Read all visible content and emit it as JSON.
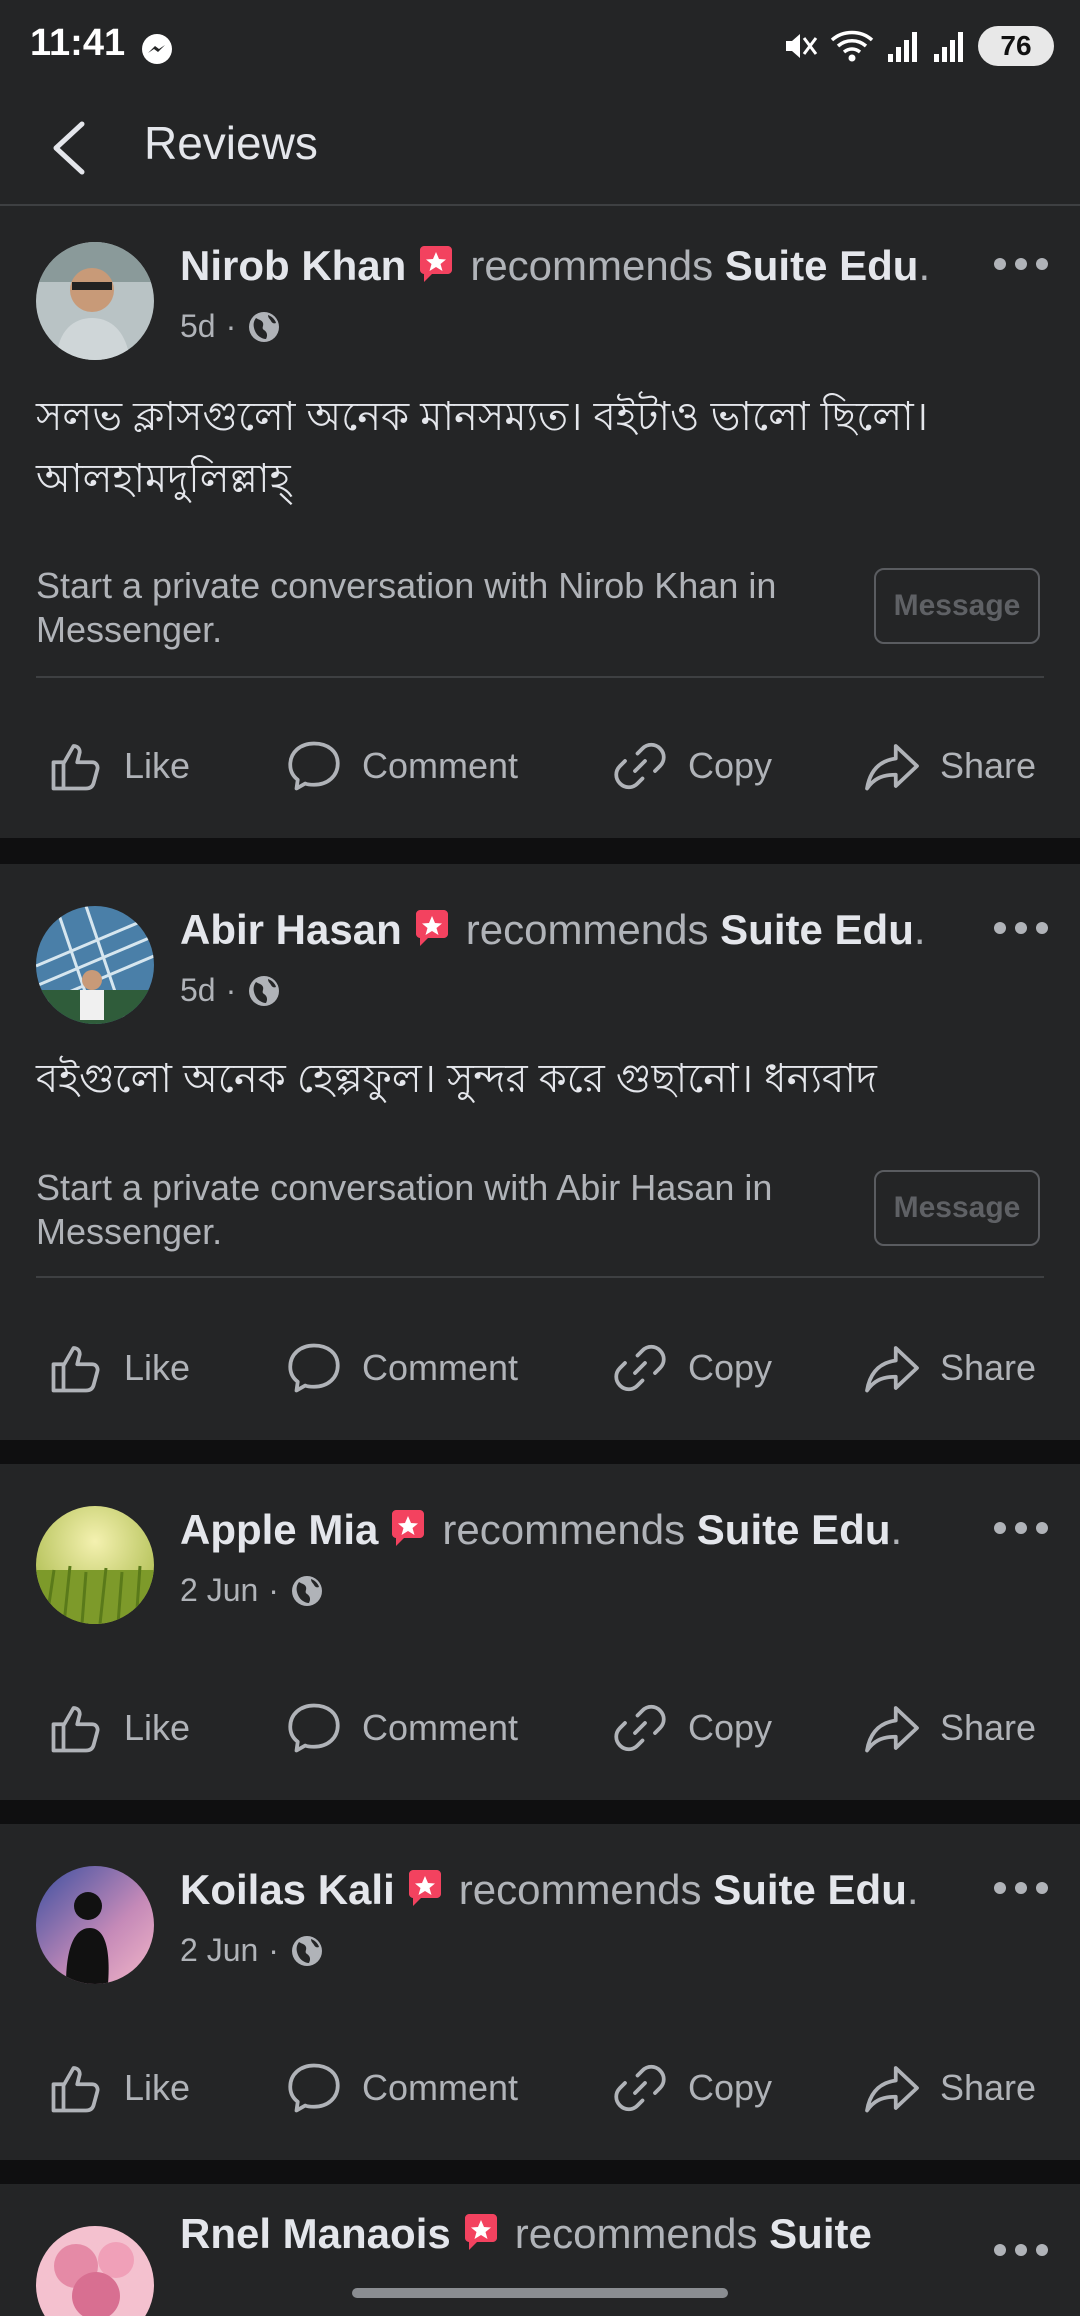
{
  "status_bar": {
    "time": "11:41",
    "battery": "76"
  },
  "header": {
    "title": "Reviews"
  },
  "reviews": [
    {
      "name": "Nirob Khan",
      "action": "recommends",
      "page": "Suite Edu",
      "time": "5d",
      "text": "সলভ ক্লাসগুলো অনেক মানসম্যত। বইটাও ভালো ছিলো। আলহামদুলিল্লাহ্",
      "private_note": "Start a private conversation with Nirob Khan in Messenger.",
      "message_label": "Message"
    },
    {
      "name": "Abir Hasan",
      "action": "recommends",
      "page": "Suite Edu",
      "time": "5d",
      "text": "বইগুলো অনেক হেল্পফুল। সুন্দর করে গুছানো। ধন্যবাদ",
      "private_note": "Start a private conversation with Abir Hasan in Messenger.",
      "message_label": "Message"
    },
    {
      "name": "Apple Mia",
      "action": "recommends",
      "page": "Suite Edu",
      "time": "2 Jun"
    },
    {
      "name": "Koilas Kali",
      "action": "recommends",
      "page": "Suite Edu",
      "time": "2 Jun"
    },
    {
      "name": "Rnel Manaois",
      "action": "recommends",
      "page": "Suite"
    }
  ],
  "actions": {
    "like": "Like",
    "comment": "Comment",
    "copy": "Copy",
    "share": "Share"
  },
  "colors": {
    "background": "#0f0f10",
    "card": "#242526",
    "text": "#e4e6eb",
    "muted": "#b0b3b8",
    "recommend_icon": "#f3425f"
  }
}
